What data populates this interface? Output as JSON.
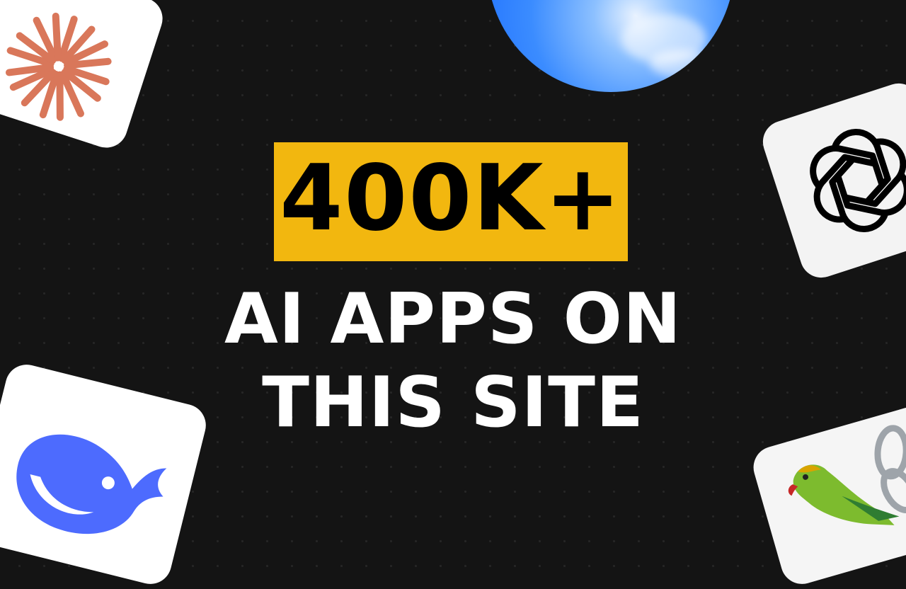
{
  "headline": {
    "value": "400K+"
  },
  "subline": {
    "line1": "AI APPS ON",
    "line2": "THIS SITE"
  },
  "colors": {
    "background": "#141414",
    "headline_box": "#F2B70F",
    "headline_text": "#000000",
    "subline_text": "#FFFFFF",
    "star_icon": "#D9775A",
    "whale_icon": "#4D6BFE",
    "orb": "#1A6BFF"
  },
  "icons": [
    "sunburst-logo-icon",
    "blue-orb-logo-icon",
    "openai-knot-logo-icon",
    "whale-logo-icon",
    "parrot-chain-logo-icon"
  ]
}
